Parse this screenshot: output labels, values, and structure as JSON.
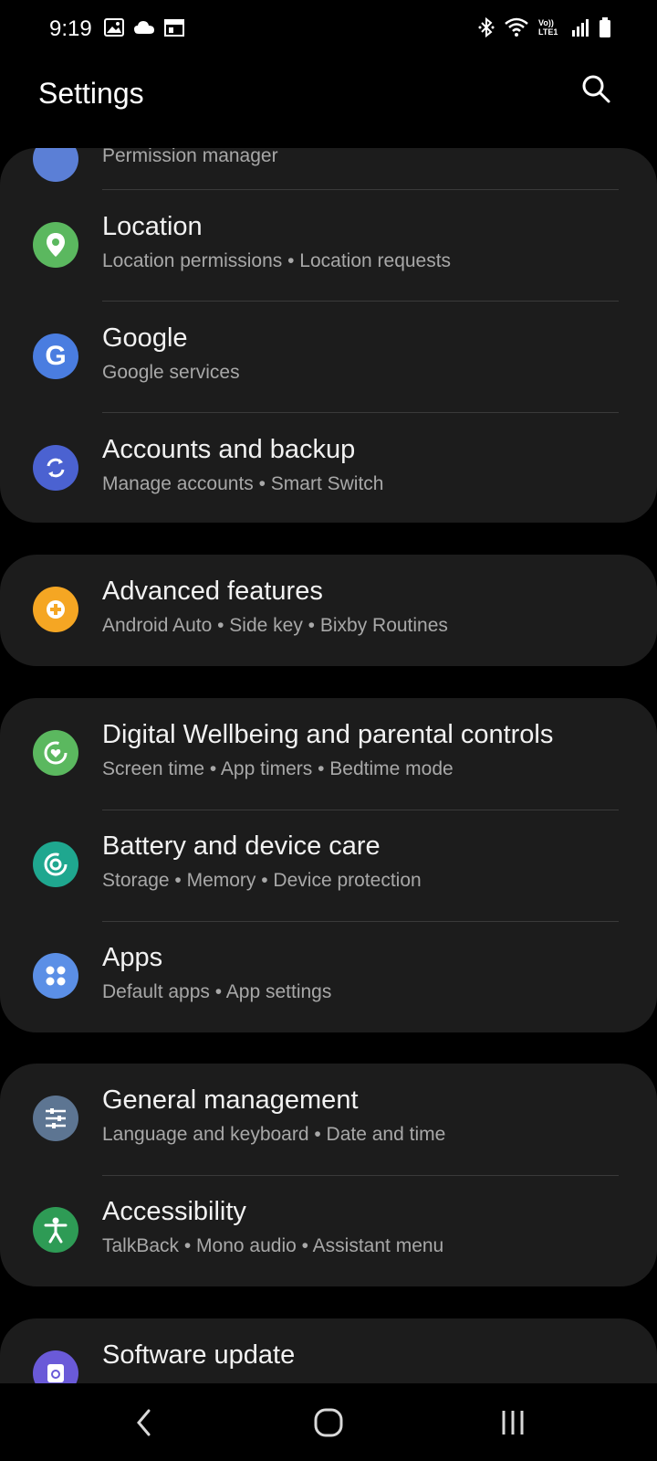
{
  "status": {
    "time": "9:19",
    "left_icons": [
      "image-icon",
      "cloud-icon",
      "calendar-icon"
    ],
    "right_icons": [
      "bluetooth-icon",
      "wifi-icon",
      "volte-icon",
      "signal-icon",
      "battery-icon"
    ],
    "volte_text": "Vo)) LTE1"
  },
  "appbar": {
    "title": "Settings"
  },
  "groups": [
    {
      "items": [
        {
          "title": "",
          "subtitle": "Permission manager",
          "icon": "privacy-icon",
          "color": "#5b7fd6"
        },
        {
          "title": "Location",
          "subtitle": "Location permissions  •  Location requests",
          "icon": "location-pin-icon",
          "color": "#5bb85f"
        },
        {
          "title": "Google",
          "subtitle": "Google services",
          "icon": "google-icon",
          "color": "#4a7de0"
        },
        {
          "title": "Accounts and backup",
          "subtitle": "Manage accounts  •  Smart Switch",
          "icon": "sync-icon",
          "color": "#4b62d1"
        }
      ]
    },
    {
      "items": [
        {
          "title": "Advanced features",
          "subtitle": "Android Auto  •  Side key  •  Bixby Routines",
          "icon": "plus-gear-icon",
          "color": "#f5a623"
        }
      ]
    },
    {
      "items": [
        {
          "title": "Digital Wellbeing and parental controls",
          "subtitle": "Screen time  •  App timers  •  Bedtime mode",
          "icon": "wellbeing-icon",
          "color": "#5bb85f"
        },
        {
          "title": "Battery and device care",
          "subtitle": "Storage  •  Memory  •  Device protection",
          "icon": "device-care-icon",
          "color": "#1fa78f"
        },
        {
          "title": "Apps",
          "subtitle": "Default apps  •  App settings",
          "icon": "apps-grid-icon",
          "color": "#5b8fe6"
        }
      ]
    },
    {
      "items": [
        {
          "title": "General management",
          "subtitle": "Language and keyboard  •  Date and time",
          "icon": "sliders-icon",
          "color": "#5d7592"
        },
        {
          "title": "Accessibility",
          "subtitle": "TalkBack  •  Mono audio  •  Assistant menu",
          "icon": "accessibility-icon",
          "color": "#2e9b55"
        }
      ]
    },
    {
      "items": [
        {
          "title": "Software update",
          "subtitle": "",
          "icon": "software-update-icon",
          "color": "#6a5ad8"
        }
      ]
    }
  ],
  "navbar": {
    "buttons": [
      "back-icon",
      "home-icon",
      "recents-icon"
    ]
  }
}
